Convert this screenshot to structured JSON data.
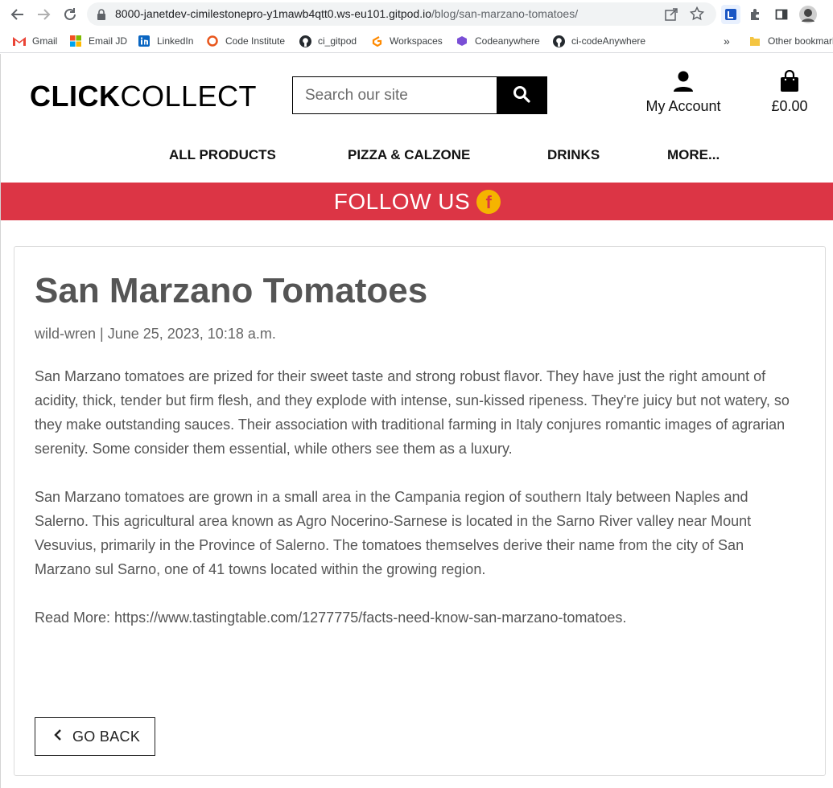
{
  "browser": {
    "url_host": "8000-janetdev-cimilestonepro-y1mawb4qtt0.ws-eu101.gitpod.io",
    "url_path": "/blog/san-marzano-tomatoes/",
    "bookmarks": [
      "Gmail",
      "Email JD",
      "LinkedIn",
      "Code Institute",
      "ci_gitpod",
      "Workspaces",
      "Codeanywhere",
      "ci-codeAnywhere"
    ],
    "overflow": "»",
    "other_bookmarks": "Other bookmarks"
  },
  "header": {
    "logo_bold": "CLICK",
    "logo_regular": "COLLECT",
    "search_placeholder": "Search our site",
    "account_label": "My Account",
    "bag_total": "£0.00"
  },
  "nav": {
    "items": [
      "ALL PRODUCTS",
      "PIZZA & CALZONE",
      "DRINKS",
      "MORE..."
    ]
  },
  "banner": {
    "text": "FOLLOW US",
    "fb_letter": "f",
    "color": "#dc3545"
  },
  "article": {
    "title": "San Marzano Tomatoes",
    "meta": "wild-wren | June 25, 2023, 10:18 a.m.",
    "paragraphs": [
      "San Marzano tomatoes are prized for their sweet taste and strong robust flavor. They have just the right amount of acidity, thick, tender but firm flesh, and they explode with intense, sun-kissed ripeness. They're juicy but not watery, so they make outstanding sauces. Their association with traditional farming in Italy conjures romantic images of agrarian serenity. Some consider them essential, while others see them as a luxury.",
      "San Marzano tomatoes are grown in a small area in the Campania region of southern Italy between Naples and Salerno. This agricultural area known as Agro Nocerino-Sarnese is located in the Sarno River valley near Mount Vesuvius, primarily in the Province of Salerno. The tomatoes themselves derive their name from the city of San Marzano sul Sarno, one of 41 towns located within the growing region.",
      "Read More: https://www.tastingtable.com/1277775/facts-need-know-san-marzano-tomatoes."
    ],
    "back_label": "GO BACK"
  }
}
